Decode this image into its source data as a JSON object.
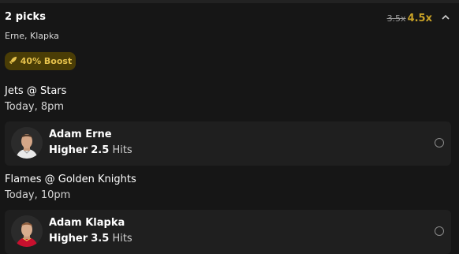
{
  "header": {
    "title": "2 picks",
    "players": "Erne, Klapka",
    "old_multiplier": "3.5x",
    "new_multiplier": "4.5x",
    "collapse_icon": "chevron-up-icon"
  },
  "boost": {
    "icon": "rocket-icon",
    "label": "40% Boost",
    "color": "#e6c24c"
  },
  "games": [
    {
      "matchup": "Jets @ Stars",
      "time": "Today, 8pm",
      "pick": {
        "player": "Adam Erne",
        "direction": "Higher",
        "line": "2.5",
        "stat": "Hits",
        "selected": false
      }
    },
    {
      "matchup": "Flames @ Golden Knights",
      "time": "Today, 10pm",
      "pick": {
        "player": "Adam Klapka",
        "direction": "Higher",
        "line": "3.5",
        "stat": "Hits",
        "selected": false
      }
    }
  ]
}
